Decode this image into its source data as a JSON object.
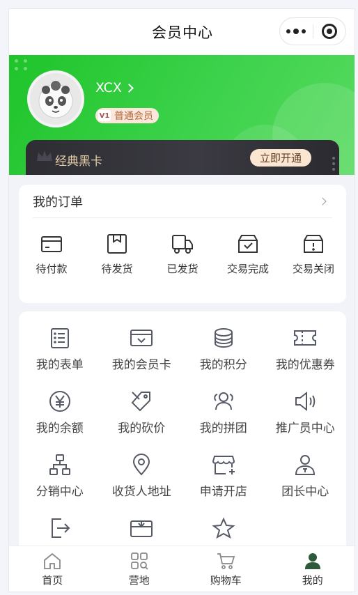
{
  "navbar": {
    "title": "会员中心"
  },
  "profile": {
    "username": "XCX",
    "level_badge": "普通会员",
    "level_icon_text": "V1"
  },
  "member_card": {
    "name": "经典黑卡",
    "action": "立即开通"
  },
  "orders": {
    "title": "我的订单",
    "items": [
      {
        "label": "待付款",
        "icon": "card-icon"
      },
      {
        "label": "待发货",
        "icon": "package-icon"
      },
      {
        "label": "已发货",
        "icon": "truck-icon"
      },
      {
        "label": "交易完成",
        "icon": "box-check-icon"
      },
      {
        "label": "交易关闭",
        "icon": "box-alert-icon"
      }
    ]
  },
  "tools": {
    "items": [
      {
        "label": "我的表单",
        "icon": "list-icon"
      },
      {
        "label": "我的会员卡",
        "icon": "member-card-icon"
      },
      {
        "label": "我的积分",
        "icon": "coins-icon"
      },
      {
        "label": "我的优惠券",
        "icon": "coupon-icon"
      },
      {
        "label": "我的余额",
        "icon": "yen-icon"
      },
      {
        "label": "我的砍价",
        "icon": "tag-cut-icon"
      },
      {
        "label": "我的拼团",
        "icon": "group-icon"
      },
      {
        "label": "推广员中心",
        "icon": "speaker-icon"
      },
      {
        "label": "分销中心",
        "icon": "org-chart-icon"
      },
      {
        "label": "收货人地址",
        "icon": "location-icon"
      },
      {
        "label": "申请开店",
        "icon": "shop-icon"
      },
      {
        "label": "团长中心",
        "icon": "leader-icon"
      },
      {
        "label": "",
        "icon": "logout-icon"
      },
      {
        "label": "",
        "icon": "gift-card-icon"
      },
      {
        "label": "",
        "icon": "star-icon"
      }
    ]
  },
  "tabbar": {
    "items": [
      {
        "label": "首页",
        "icon": "home-icon",
        "active": false
      },
      {
        "label": "营地",
        "icon": "grid-icon",
        "active": false
      },
      {
        "label": "购物车",
        "icon": "cart-icon",
        "active": false
      },
      {
        "label": "我的",
        "icon": "user-icon",
        "active": true
      }
    ]
  },
  "colors": {
    "accent_green": "#22c52e",
    "active_tab": "#2d5a3a",
    "icon_gray": "#555a66"
  }
}
